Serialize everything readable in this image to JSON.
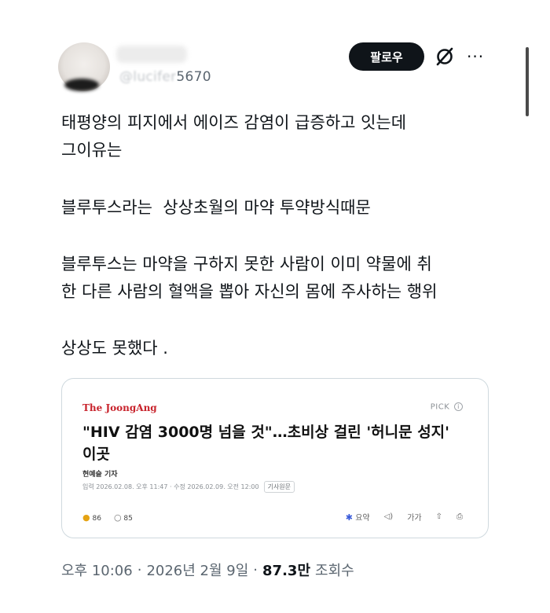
{
  "user": {
    "handle_hidden": "@lucifer",
    "handle_visible": "5670"
  },
  "header": {
    "follow_label": "팔로우",
    "more_label": "···"
  },
  "tweet": {
    "lines": [
      "태평양의 피지에서 에이즈 감염이 급증하고 잇는데",
      "그이유는",
      "블루투스라는  상상초월의 마약 투약방식때문",
      "블루투스는 마약을 구하지 못한 사람이 이미 약물에 취",
      "한 다른 사람의 혈액을 뽑아 자신의 몸에 주사하는 행위",
      "상상도 못했다 ."
    ]
  },
  "card": {
    "brand": "The JoongAng",
    "pick_label": "PICK",
    "pick_symbol": "i",
    "headline_1": "\"HIV 감염 3000명 넘을 것\"…초비상 걸린 '허니문 성지'",
    "headline_2": "이곳",
    "reporter": "현예슬 기자",
    "dateline": "입력 2026.02.08. 오후 11:47 · 수정 2026.02.09. 오전 12:00",
    "original_label": "기사원문",
    "reactions_count": "86",
    "comments_count": "85",
    "summary_label": "요약",
    "text_size_label": "가가"
  },
  "footer": {
    "time": "오후 10:06",
    "separator": "·",
    "date": "2026년 2월 9일",
    "views": "87.3만",
    "views_label": "조회수"
  },
  "colors": {
    "follow_bg": "#0f1419",
    "brand_red": "#c8232c",
    "muted": "#5b6670"
  }
}
